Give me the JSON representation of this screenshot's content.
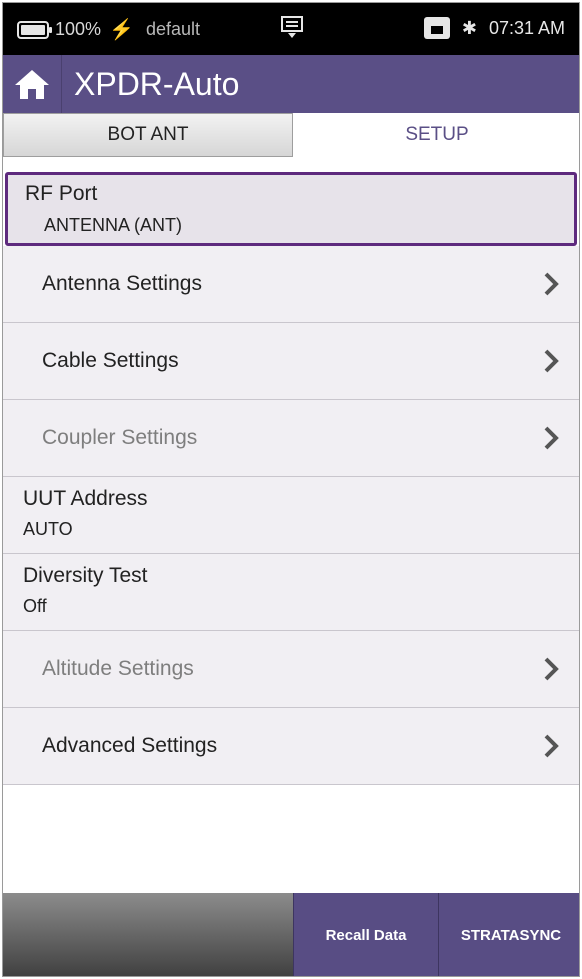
{
  "status_bar": {
    "battery": "100%",
    "profile": "default",
    "time": "07:31 AM"
  },
  "app_bar": {
    "title": "XPDR-Auto"
  },
  "tabs": [
    {
      "label": "BOT ANT",
      "active": false
    },
    {
      "label": "SETUP",
      "active": true
    }
  ],
  "list": {
    "rf_port": {
      "title": "RF Port",
      "value": "ANTENNA (ANT)"
    },
    "antenna_settings": {
      "label": "Antenna Settings"
    },
    "cable_settings": {
      "label": "Cable Settings"
    },
    "coupler_settings": {
      "label": "Coupler Settings"
    },
    "uut_address": {
      "title": "UUT Address",
      "value": "AUTO"
    },
    "diversity_test": {
      "title": "Diversity Test",
      "value": "Off"
    },
    "altitude_settings": {
      "label": "Altitude Settings"
    },
    "advanced_settings": {
      "label": "Advanced Settings"
    }
  },
  "bottom_bar": {
    "recall_label": "Recall Data",
    "stratasync_label": "STRATASYNC"
  },
  "colors": {
    "app_bar": "#5a4f86",
    "selected_border": "#5e2a7e",
    "row_bg": "#f1eff3"
  }
}
